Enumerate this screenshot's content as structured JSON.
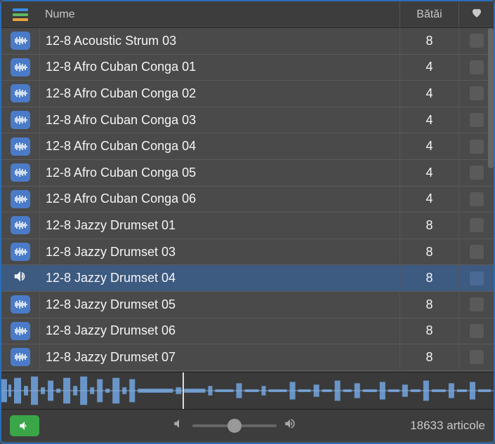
{
  "header": {
    "col_name": "Nume",
    "col_beats": "Bătăi"
  },
  "rows": [
    {
      "name": "12-8 Acoustic Strum 03",
      "beats": "8",
      "selected": false
    },
    {
      "name": "12-8 Afro Cuban Conga 01",
      "beats": "4",
      "selected": false
    },
    {
      "name": "12-8 Afro Cuban Conga 02",
      "beats": "4",
      "selected": false
    },
    {
      "name": "12-8 Afro Cuban Conga 03",
      "beats": "4",
      "selected": false
    },
    {
      "name": "12-8 Afro Cuban Conga 04",
      "beats": "4",
      "selected": false
    },
    {
      "name": "12-8 Afro Cuban Conga 05",
      "beats": "4",
      "selected": false
    },
    {
      "name": "12-8 Afro Cuban Conga 06",
      "beats": "4",
      "selected": false
    },
    {
      "name": "12-8 Jazzy Drumset 01",
      "beats": "8",
      "selected": false
    },
    {
      "name": "12-8 Jazzy Drumset 03",
      "beats": "8",
      "selected": false
    },
    {
      "name": "12-8 Jazzy Drumset 04",
      "beats": "8",
      "selected": true
    },
    {
      "name": "12-8 Jazzy Drumset 05",
      "beats": "8",
      "selected": false
    },
    {
      "name": "12-8 Jazzy Drumset 06",
      "beats": "8",
      "selected": false
    },
    {
      "name": "12-8 Jazzy Drumset 07",
      "beats": "8",
      "selected": false
    }
  ],
  "footer": {
    "count_text": "18633 articole"
  }
}
